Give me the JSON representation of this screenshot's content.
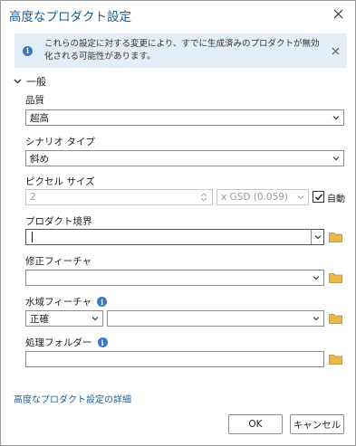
{
  "dialog": {
    "title": "高度なプロダクト設定",
    "info_message": "これらの設定に対する変更により、すでに生成済みのプロダクトが無効化される可能性があります。"
  },
  "section": {
    "label": "一般"
  },
  "quality": {
    "label": "品質",
    "value": "超高"
  },
  "scenario": {
    "label": "シナリオ タイプ",
    "value": "斜め"
  },
  "pixel_size": {
    "label": "ピクセル サイズ",
    "value": "2",
    "unit_value": "x GSD (0.059)",
    "auto_label": "自動",
    "auto_checked": true
  },
  "product_boundary": {
    "label": "プロダクト境界",
    "value": ""
  },
  "correction_features": {
    "label": "修正フィーチャ",
    "value": ""
  },
  "water_features": {
    "label": "水域フィーチャ",
    "mode_value": "正確",
    "value": ""
  },
  "processing_folder": {
    "label": "処理フォルダー",
    "value": ""
  },
  "details_link": "高度なプロダクト設定の詳細",
  "buttons": {
    "ok": "OK",
    "cancel": "キャンセル"
  },
  "colors": {
    "accent": "#1c5f96",
    "info_bg": "#e3eef8",
    "info_icon": "#3b78c3",
    "folder": "#e8b94a"
  },
  "icons": {
    "close": "close-icon",
    "info": "info-icon",
    "chevron": "chevron-down-icon",
    "folder": "folder-icon",
    "spin": "spin-arrows-icon",
    "check": "checkmark-icon"
  }
}
